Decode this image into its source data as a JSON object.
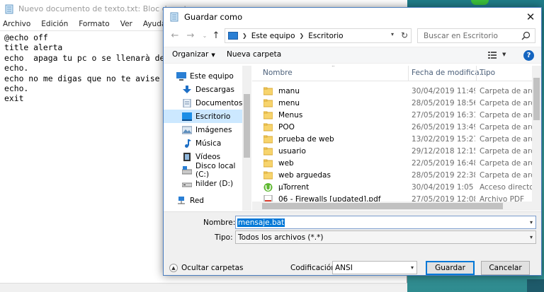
{
  "notepad": {
    "title": "Nuevo documento de texto.txt: Bloc de notas",
    "menu": [
      "Archivo",
      "Edición",
      "Formato",
      "Ver",
      "Ayuda"
    ],
    "content": "@echo off\ntitle alerta\necho  apaga tu pc o se llenarà de v\necho.\necho no me digas que no te avise ja\necho.\nexit"
  },
  "dialog": {
    "title": "Guardar como",
    "close_glyph": "✕",
    "address": {
      "crumbs": [
        "Este equipo",
        "Escritorio"
      ]
    },
    "search_placeholder": "Buscar en Escritorio",
    "toolbar": {
      "organize": "Organizar",
      "new_folder": "Nueva carpeta",
      "help": "?"
    },
    "nav_items": [
      {
        "label": "Este equipo",
        "icon": "pc-icon"
      },
      {
        "label": "Descargas",
        "icon": "download-icon"
      },
      {
        "label": "Documentos",
        "icon": "documents-icon"
      },
      {
        "label": "Escritorio",
        "icon": "desktop-icon",
        "selected": true
      },
      {
        "label": "Imágenes",
        "icon": "images-icon"
      },
      {
        "label": "Música",
        "icon": "music-icon"
      },
      {
        "label": "Vídeos",
        "icon": "video-icon"
      },
      {
        "label": "Disco local (C:)",
        "icon": "drive-icon"
      },
      {
        "label": "hilder (D:)",
        "icon": "usb-drive-icon"
      },
      {
        "label": "Red",
        "icon": "network-icon"
      }
    ],
    "columns": [
      "Nombre",
      "Fecha de modifica...",
      "Tipo"
    ],
    "files": [
      {
        "name": "manu",
        "date": "30/04/2019 11:49",
        "type": "Carpeta de archivos",
        "icon": "folder-icon"
      },
      {
        "name": "menu",
        "date": "28/05/2019 18:56",
        "type": "Carpeta de archivos",
        "icon": "folder-icon"
      },
      {
        "name": "Menus",
        "date": "27/05/2019 16:31",
        "type": "Carpeta de archivos",
        "icon": "folder-icon"
      },
      {
        "name": "POO",
        "date": "26/05/2019 13:49",
        "type": "Carpeta de archivos",
        "icon": "folder-icon"
      },
      {
        "name": "prueba de web",
        "date": "13/02/2019 15:27",
        "type": "Carpeta de archivos",
        "icon": "folder-icon"
      },
      {
        "name": "usuario",
        "date": "29/12/2018 12:15",
        "type": "Carpeta de archivos",
        "icon": "folder-icon"
      },
      {
        "name": "web",
        "date": "22/05/2019 16:48",
        "type": "Carpeta de archivos",
        "icon": "folder-icon"
      },
      {
        "name": "web arguedas",
        "date": "28/05/2019 22:38",
        "type": "Carpeta de archivos",
        "icon": "folder-icon"
      },
      {
        "name": "µTorrent",
        "date": "30/04/2019 1:05",
        "type": "Acceso directo",
        "icon": "utorrent-icon"
      },
      {
        "name": "06 - Firewalls [updated].pdf",
        "date": "27/05/2019 12:08",
        "type": "Archivo PDF",
        "icon": "pdf-icon"
      }
    ],
    "form": {
      "name_label": "Nombre:",
      "name_value": "mensaje.bat",
      "type_label": "Tipo:",
      "type_value": "Todos los archivos  (*.*)",
      "hide_folders": "Ocultar carpetas",
      "encoding_label": "Codificación:",
      "encoding_value": "ANSI",
      "save_label": "Guardar",
      "cancel_label": "Cancelar"
    }
  }
}
